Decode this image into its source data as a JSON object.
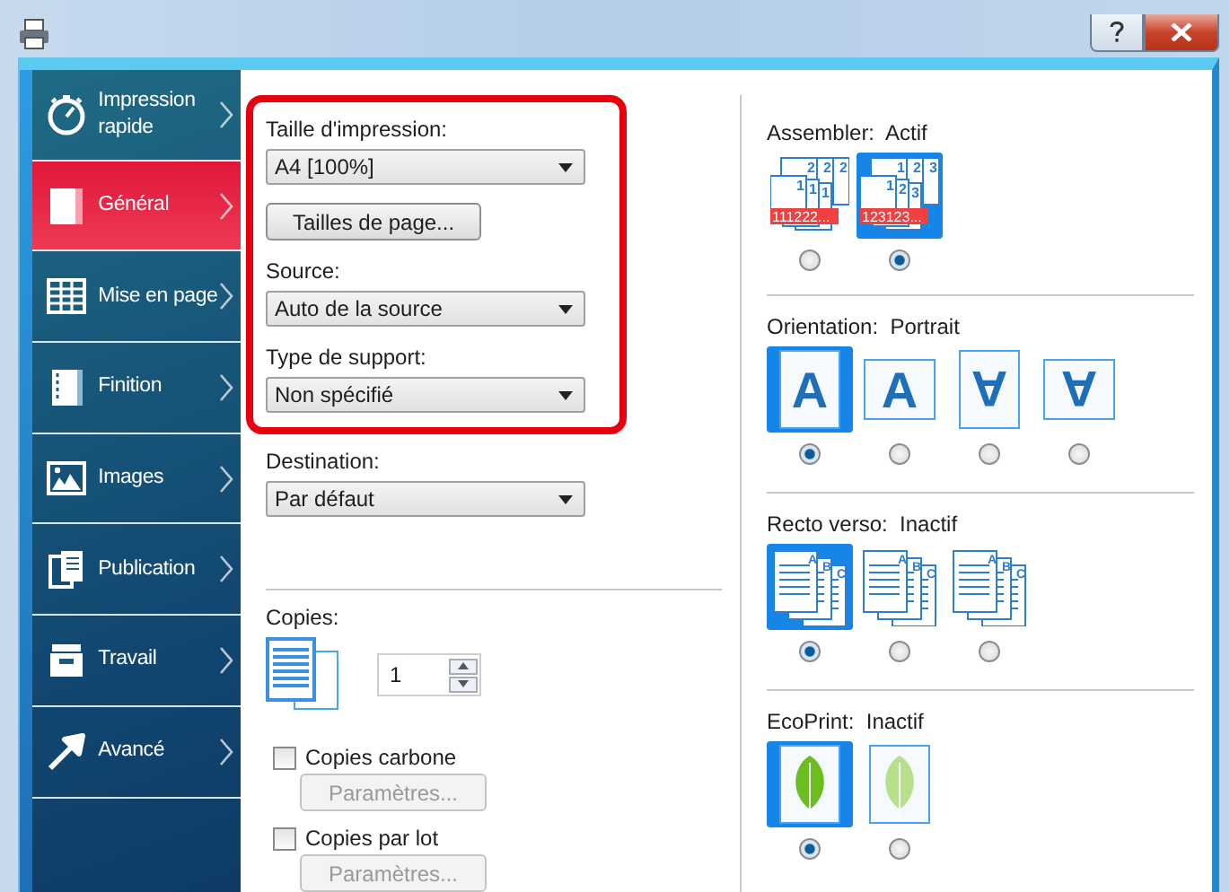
{
  "sidebar": {
    "items": [
      {
        "label": "Impression rapide",
        "selected": false
      },
      {
        "label": "Général",
        "selected": true
      },
      {
        "label": "Mise en page",
        "selected": false
      },
      {
        "label": "Finition",
        "selected": false
      },
      {
        "label": "Images",
        "selected": false
      },
      {
        "label": "Publication",
        "selected": false
      },
      {
        "label": "Travail",
        "selected": false
      },
      {
        "label": "Avancé",
        "selected": false
      }
    ]
  },
  "general": {
    "fields": [
      {
        "kind": "select",
        "label": "Taille d'impression:",
        "value": "A4  [100%]",
        "highlighted": true
      },
      {
        "kind": "button",
        "label": "Tailles de page...",
        "highlighted": true
      },
      {
        "kind": "select",
        "label": "Source:",
        "value": "Auto de la source",
        "highlighted": true
      },
      {
        "kind": "select",
        "label": "Type de support:",
        "value": "Non spécifié",
        "highlighted": true
      },
      {
        "kind": "select",
        "label": "Destination:",
        "value": "Par défaut",
        "highlighted": false
      }
    ]
  },
  "copies": {
    "label": "Copies:",
    "value": "1"
  },
  "checkboxes": [
    {
      "label": "Copies carbone",
      "checked": false,
      "button": "Paramètres...",
      "button_disabled": true
    },
    {
      "label": "Copies par lot",
      "checked": false,
      "button": "Paramètres...",
      "button_disabled": true
    }
  ],
  "sections": [
    {
      "kind": "collate",
      "title": "Assembler:",
      "value": "Actif",
      "options": [
        {
          "selected": false,
          "digits": [
            "2",
            "2",
            "2",
            "1",
            "1",
            "1"
          ],
          "caption": "111222..."
        },
        {
          "selected": true,
          "digits": [
            "1",
            "2",
            "3",
            "1",
            "2",
            "3"
          ],
          "caption": "123123..."
        }
      ]
    },
    {
      "kind": "orientation",
      "title": "Orientation:",
      "value": "Portrait",
      "options": [
        {
          "selected": true,
          "glyph": "A",
          "landscape": false,
          "flipped": false
        },
        {
          "selected": false,
          "glyph": "A",
          "landscape": true,
          "flipped": false
        },
        {
          "selected": false,
          "glyph": "A",
          "landscape": false,
          "flipped": true
        },
        {
          "selected": false,
          "glyph": "A",
          "landscape": true,
          "flipped": true
        }
      ]
    },
    {
      "kind": "duplex",
      "title": "Recto verso:",
      "value": "Inactif",
      "options": [
        {
          "selected": true,
          "letters": [
            "A",
            "B",
            "C"
          ]
        },
        {
          "selected": false,
          "letters": [
            "A",
            "B",
            "C"
          ]
        },
        {
          "selected": false,
          "letters": [
            "A",
            "B",
            "C"
          ]
        }
      ]
    },
    {
      "kind": "ecoprint",
      "title": "EcoPrint:",
      "value": "Inactif",
      "options": [
        {
          "selected": true,
          "faded": false
        },
        {
          "selected": false,
          "faded": true
        }
      ]
    }
  ]
}
